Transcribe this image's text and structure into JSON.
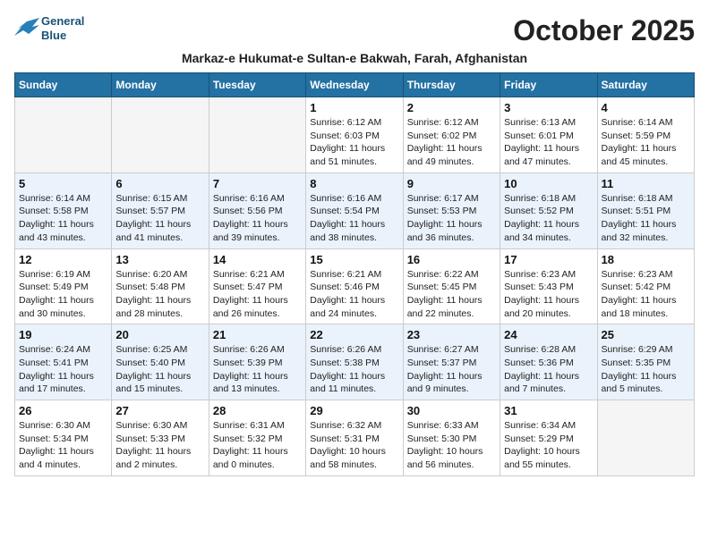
{
  "logo": {
    "line1": "General",
    "line2": "Blue"
  },
  "title": "October 2025",
  "subtitle": "Markaz-e Hukumat-e Sultan-e Bakwah, Farah, Afghanistan",
  "headers": [
    "Sunday",
    "Monday",
    "Tuesday",
    "Wednesday",
    "Thursday",
    "Friday",
    "Saturday"
  ],
  "weeks": [
    [
      {
        "day": "",
        "info": ""
      },
      {
        "day": "",
        "info": ""
      },
      {
        "day": "",
        "info": ""
      },
      {
        "day": "1",
        "info": "Sunrise: 6:12 AM\nSunset: 6:03 PM\nDaylight: 11 hours\nand 51 minutes."
      },
      {
        "day": "2",
        "info": "Sunrise: 6:12 AM\nSunset: 6:02 PM\nDaylight: 11 hours\nand 49 minutes."
      },
      {
        "day": "3",
        "info": "Sunrise: 6:13 AM\nSunset: 6:01 PM\nDaylight: 11 hours\nand 47 minutes."
      },
      {
        "day": "4",
        "info": "Sunrise: 6:14 AM\nSunset: 5:59 PM\nDaylight: 11 hours\nand 45 minutes."
      }
    ],
    [
      {
        "day": "5",
        "info": "Sunrise: 6:14 AM\nSunset: 5:58 PM\nDaylight: 11 hours\nand 43 minutes."
      },
      {
        "day": "6",
        "info": "Sunrise: 6:15 AM\nSunset: 5:57 PM\nDaylight: 11 hours\nand 41 minutes."
      },
      {
        "day": "7",
        "info": "Sunrise: 6:16 AM\nSunset: 5:56 PM\nDaylight: 11 hours\nand 39 minutes."
      },
      {
        "day": "8",
        "info": "Sunrise: 6:16 AM\nSunset: 5:54 PM\nDaylight: 11 hours\nand 38 minutes."
      },
      {
        "day": "9",
        "info": "Sunrise: 6:17 AM\nSunset: 5:53 PM\nDaylight: 11 hours\nand 36 minutes."
      },
      {
        "day": "10",
        "info": "Sunrise: 6:18 AM\nSunset: 5:52 PM\nDaylight: 11 hours\nand 34 minutes."
      },
      {
        "day": "11",
        "info": "Sunrise: 6:18 AM\nSunset: 5:51 PM\nDaylight: 11 hours\nand 32 minutes."
      }
    ],
    [
      {
        "day": "12",
        "info": "Sunrise: 6:19 AM\nSunset: 5:49 PM\nDaylight: 11 hours\nand 30 minutes."
      },
      {
        "day": "13",
        "info": "Sunrise: 6:20 AM\nSunset: 5:48 PM\nDaylight: 11 hours\nand 28 minutes."
      },
      {
        "day": "14",
        "info": "Sunrise: 6:21 AM\nSunset: 5:47 PM\nDaylight: 11 hours\nand 26 minutes."
      },
      {
        "day": "15",
        "info": "Sunrise: 6:21 AM\nSunset: 5:46 PM\nDaylight: 11 hours\nand 24 minutes."
      },
      {
        "day": "16",
        "info": "Sunrise: 6:22 AM\nSunset: 5:45 PM\nDaylight: 11 hours\nand 22 minutes."
      },
      {
        "day": "17",
        "info": "Sunrise: 6:23 AM\nSunset: 5:43 PM\nDaylight: 11 hours\nand 20 minutes."
      },
      {
        "day": "18",
        "info": "Sunrise: 6:23 AM\nSunset: 5:42 PM\nDaylight: 11 hours\nand 18 minutes."
      }
    ],
    [
      {
        "day": "19",
        "info": "Sunrise: 6:24 AM\nSunset: 5:41 PM\nDaylight: 11 hours\nand 17 minutes."
      },
      {
        "day": "20",
        "info": "Sunrise: 6:25 AM\nSunset: 5:40 PM\nDaylight: 11 hours\nand 15 minutes."
      },
      {
        "day": "21",
        "info": "Sunrise: 6:26 AM\nSunset: 5:39 PM\nDaylight: 11 hours\nand 13 minutes."
      },
      {
        "day": "22",
        "info": "Sunrise: 6:26 AM\nSunset: 5:38 PM\nDaylight: 11 hours\nand 11 minutes."
      },
      {
        "day": "23",
        "info": "Sunrise: 6:27 AM\nSunset: 5:37 PM\nDaylight: 11 hours\nand 9 minutes."
      },
      {
        "day": "24",
        "info": "Sunrise: 6:28 AM\nSunset: 5:36 PM\nDaylight: 11 hours\nand 7 minutes."
      },
      {
        "day": "25",
        "info": "Sunrise: 6:29 AM\nSunset: 5:35 PM\nDaylight: 11 hours\nand 5 minutes."
      }
    ],
    [
      {
        "day": "26",
        "info": "Sunrise: 6:30 AM\nSunset: 5:34 PM\nDaylight: 11 hours\nand 4 minutes."
      },
      {
        "day": "27",
        "info": "Sunrise: 6:30 AM\nSunset: 5:33 PM\nDaylight: 11 hours\nand 2 minutes."
      },
      {
        "day": "28",
        "info": "Sunrise: 6:31 AM\nSunset: 5:32 PM\nDaylight: 11 hours\nand 0 minutes."
      },
      {
        "day": "29",
        "info": "Sunrise: 6:32 AM\nSunset: 5:31 PM\nDaylight: 10 hours\nand 58 minutes."
      },
      {
        "day": "30",
        "info": "Sunrise: 6:33 AM\nSunset: 5:30 PM\nDaylight: 10 hours\nand 56 minutes."
      },
      {
        "day": "31",
        "info": "Sunrise: 6:34 AM\nSunset: 5:29 PM\nDaylight: 10 hours\nand 55 minutes."
      },
      {
        "day": "",
        "info": ""
      }
    ]
  ]
}
